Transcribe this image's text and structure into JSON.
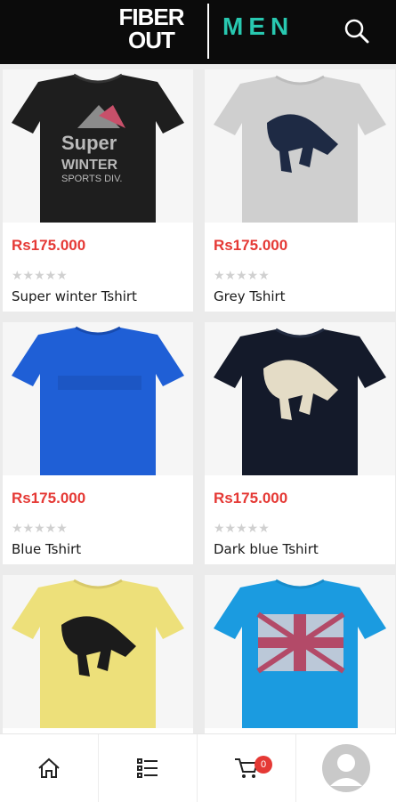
{
  "header": {
    "logo_line1": "FIBER",
    "logo_line2": "OUT",
    "category": "MEN"
  },
  "products": [
    {
      "price": "Rs175.000",
      "stars": "★★★★★",
      "title": "Super winter Tshirt",
      "image": "black tshirt with Super WINTER SPORTS DIV. print"
    },
    {
      "price": "Rs175.000",
      "stars": "★★★★★",
      "title": "Grey Tshirt",
      "image": "grey tshirt with horse print"
    },
    {
      "price": "Rs175.000",
      "stars": "★★★★★",
      "title": "Blue Tshirt",
      "image": "blue tshirt"
    },
    {
      "price": "Rs175.000",
      "stars": "★★★★★",
      "title": "Dark blue Tshirt",
      "image": "dark blue tshirt with horse print"
    },
    {
      "price": "",
      "stars": "",
      "title": "",
      "image": "yellow tshirt with horse print"
    },
    {
      "price": "",
      "stars": "",
      "title": "",
      "image": "light blue tshirt with union jack print"
    }
  ],
  "print_text": {
    "super": "Super",
    "winter": "WINTER",
    "sports": "SPORTS DIV."
  },
  "cart": {
    "count": "0"
  },
  "icons": {
    "search": "search-icon",
    "home": "home-icon",
    "list": "list-icon",
    "cart": "cart-icon",
    "avatar": "avatar-icon"
  },
  "colors": {
    "header_bg": "#0b0b0b",
    "accent": "#28c8b0",
    "price": "#e53935",
    "badge": "#e53935"
  }
}
